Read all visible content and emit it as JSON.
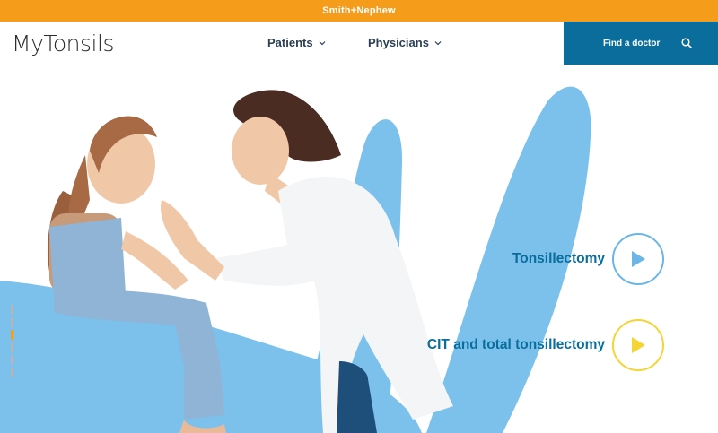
{
  "top_bar": {
    "brand": "Smith+Nephew"
  },
  "nav": {
    "logo": "MyTonsils",
    "items": [
      {
        "label": "Patients"
      },
      {
        "label": "Physicians"
      }
    ],
    "find_doctor": "Find a doctor"
  },
  "hero": {
    "slides": 6,
    "active_slide": 4,
    "ctas": [
      {
        "label": "Tonsillectomy",
        "icon": "play-icon"
      },
      {
        "label": "CIT and total tonsillectomy",
        "icon": "play-icon"
      }
    ]
  },
  "colors": {
    "orange": "#f59d1a",
    "blue": "#0a6d9c",
    "sky": "#7cc1ec",
    "yellow": "#f5d437"
  }
}
